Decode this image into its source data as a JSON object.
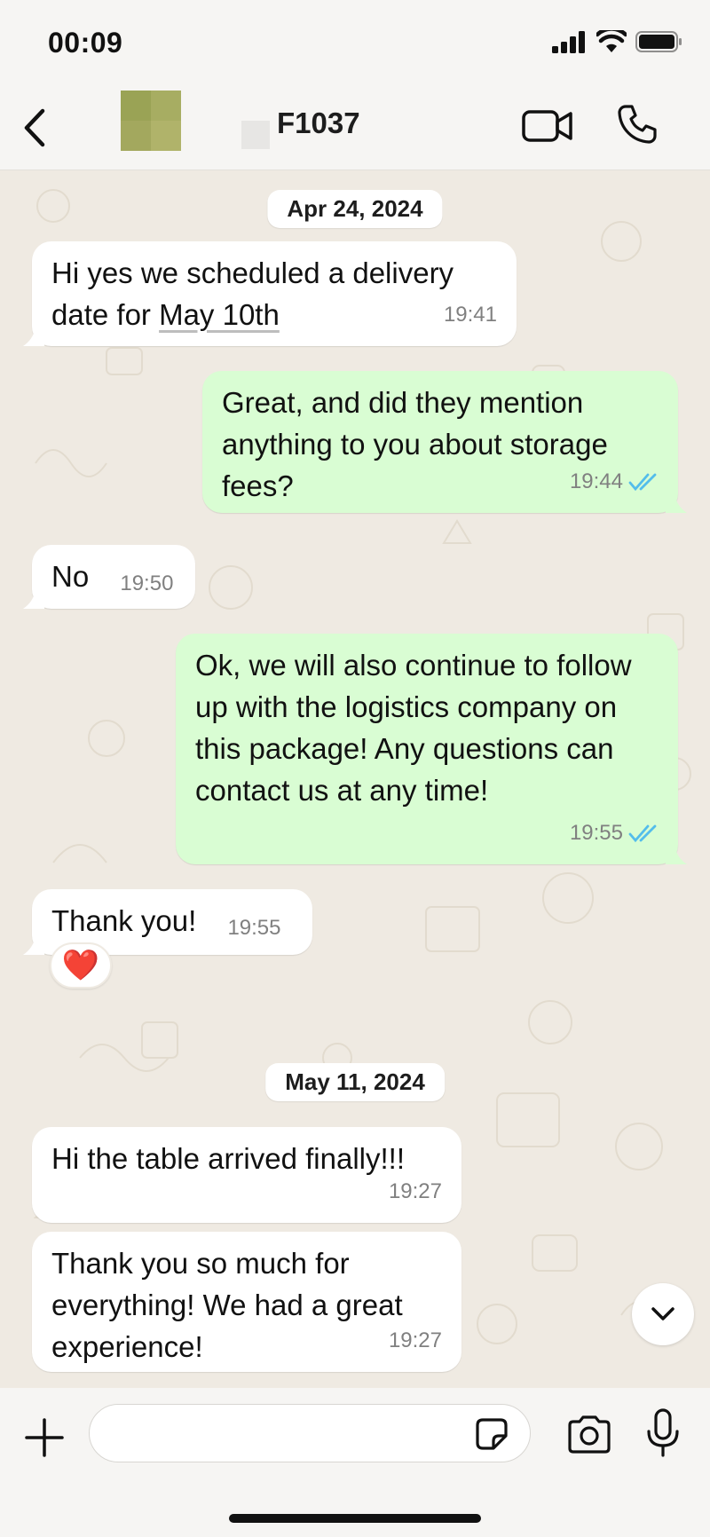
{
  "status_bar": {
    "time": "00:09"
  },
  "header": {
    "contact_name": "F1037"
  },
  "colors": {
    "incoming_bubble": "#ffffff",
    "outgoing_bubble": "#d9fdd3",
    "read_ticks": "#53bdeb",
    "chat_background": "#efeae2"
  },
  "icons": {
    "back": "chevron-left-icon",
    "video": "video-camera-icon",
    "call": "phone-icon",
    "read_receipt": "double-check-icon",
    "scroll_down": "chevron-down-icon",
    "attach": "plus-icon",
    "sticker": "sticker-icon",
    "camera": "camera-icon",
    "mic": "microphone-icon"
  },
  "conversation": {
    "date_1": "Apr 24, 2024",
    "date_2": "May 11, 2024",
    "messages": [
      {
        "direction": "incoming",
        "text_part1": "Hi yes we scheduled a delivery",
        "text_part2": "date for ",
        "link_text": "May 10th",
        "time": "19:41"
      },
      {
        "direction": "outgoing",
        "text": "Great, and did they mention anything to you about storage fees?",
        "time": "19:44",
        "status": "read"
      },
      {
        "direction": "incoming",
        "text": "No",
        "time": "19:50"
      },
      {
        "direction": "outgoing",
        "text": "Ok, we will also continue to follow up with the logistics company on this package! Any questions can contact us at any time!",
        "time": "19:55",
        "status": "read"
      },
      {
        "direction": "incoming",
        "text": "Thank you!",
        "time": "19:55",
        "reaction": "❤️"
      },
      {
        "direction": "incoming",
        "text": "Hi the table arrived finally!!!",
        "time": "19:27"
      },
      {
        "direction": "incoming",
        "text": "Thank you so much for everything! We had a great experience!",
        "time": "19:27"
      }
    ]
  },
  "composer": {
    "placeholder": "",
    "value": ""
  }
}
